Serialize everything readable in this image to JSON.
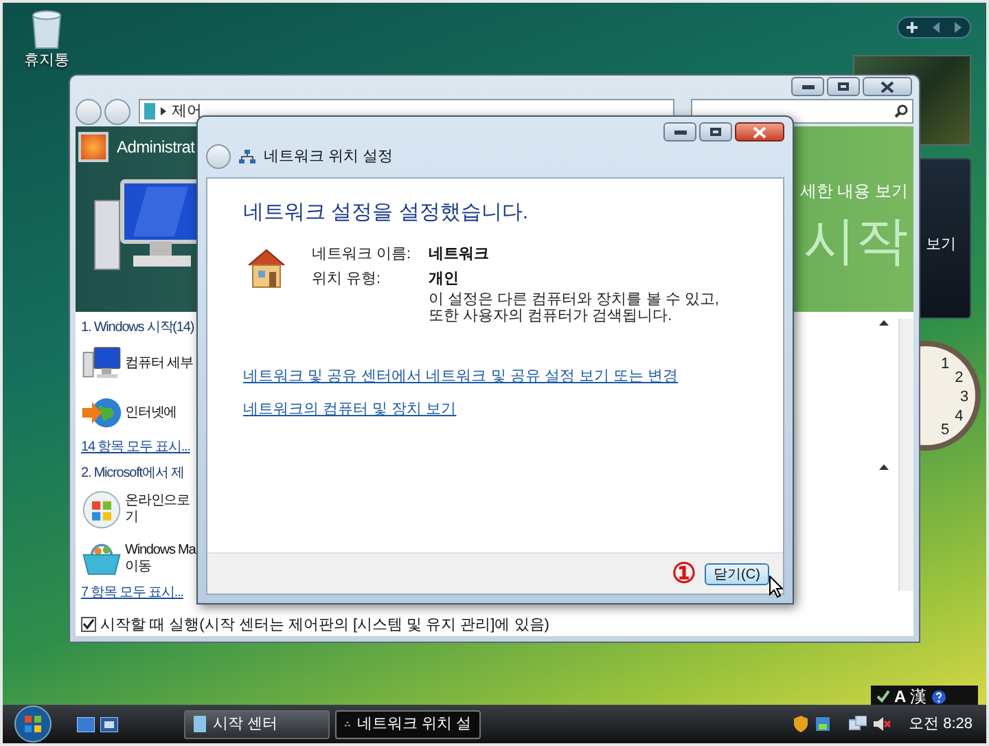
{
  "desktop": {
    "icons": [
      {
        "label": "휴지통"
      }
    ]
  },
  "gadgets": {
    "slideshow_caption": "보기",
    "clock_numerals": [
      "1",
      "2",
      "3",
      "4",
      "5"
    ]
  },
  "back_window": {
    "address": "제어",
    "header": {
      "user": "Administrat",
      "details_link": "세한 내용 보기",
      "title": "시작"
    },
    "sections": [
      {
        "title": "1. Windows 시작(14)",
        "items": [
          {
            "kind": "computer",
            "lines": [
              "컴퓨터 세부"
            ]
          },
          {
            "kind": "globe",
            "lines": [
              "인터넷에"
            ]
          }
        ],
        "more_link": "14 항목 모두 표시..."
      },
      {
        "title": "2. Microsoft에서 제",
        "items": [
          {
            "kind": "orb",
            "lines": [
              "온라인으로",
              "기"
            ]
          },
          {
            "kind": "basket",
            "lines": [
              "Windows Ma",
              "이동"
            ]
          }
        ],
        "more_link": "7 항목 모두 표시..."
      }
    ],
    "startup_checkbox": {
      "label": "시작할 때 실행(시작 센터는 제어판의 [시스템 및 유지 관리]에 있음)",
      "checked": true
    }
  },
  "dialog": {
    "title": "네트워크 위치 설정",
    "heading": "네트워크 설정을 설정했습니다.",
    "fields": [
      {
        "label": "네트워크 이름:",
        "value": "네트워크"
      },
      {
        "label": "위치 유형:",
        "value": "개인",
        "description_lines": [
          "이 설정은 다른 컴퓨터와 장치를 볼 수 있고,",
          "또한 사용자의 컴퓨터가 검색됩니다."
        ]
      }
    ],
    "links": [
      "네트워크 및 공유 센터에서 네트워크 및 공유 설정 보기 또는 변경",
      "네트워크의 컴퓨터 및 장치 보기"
    ],
    "callout": "①",
    "close_button": "닫기(C)"
  },
  "language_bar": {
    "mode": "A",
    "hanja": "漢"
  },
  "taskbar": {
    "buttons": [
      {
        "label": "시작 센터",
        "selected": false
      },
      {
        "label": "네트워크 위치 설",
        "selected": true
      }
    ],
    "clock": "오전 8:28"
  }
}
